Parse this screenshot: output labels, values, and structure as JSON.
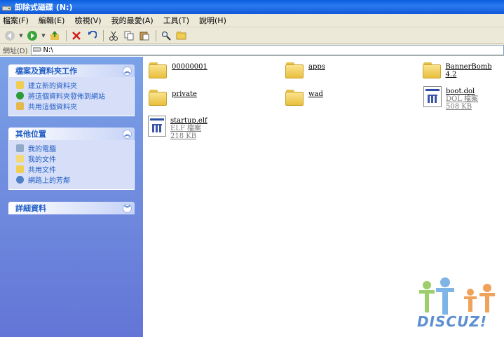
{
  "window": {
    "title": "卸除式磁碟 (N:)"
  },
  "menu": [
    "檔案(F)",
    "編輯(E)",
    "檢視(V)",
    "我的最愛(A)",
    "工具(T)",
    "說明(H)"
  ],
  "address": {
    "label": "網址(D)",
    "value": "N:\\"
  },
  "panels": {
    "tasks": {
      "title": "檔案及資料夾工作",
      "items": [
        "建立新的資料夾",
        "將這個資料夾發佈到網站",
        "共用這個資料夾"
      ]
    },
    "places": {
      "title": "其他位置",
      "items": [
        "我的電腦",
        "我的文件",
        "共用文件",
        "網路上的芳鄰"
      ]
    },
    "details": {
      "title": "詳細資料"
    }
  },
  "files": [
    {
      "name": "00000001",
      "type": "folder"
    },
    {
      "name": "apps",
      "type": "folder"
    },
    {
      "name": "BannerBomb 4.2",
      "type": "folder"
    },
    {
      "name": "private",
      "type": "folder"
    },
    {
      "name": "wad",
      "type": "folder"
    },
    {
      "name": "boot.dol",
      "type": "file",
      "kind": "DOL 檔案",
      "size": "508 KB"
    },
    {
      "name": "startup.elf",
      "type": "file",
      "kind": "ELF 檔案",
      "size": "218 KB"
    }
  ],
  "watermark": {
    "text": "DISCUZ!"
  }
}
